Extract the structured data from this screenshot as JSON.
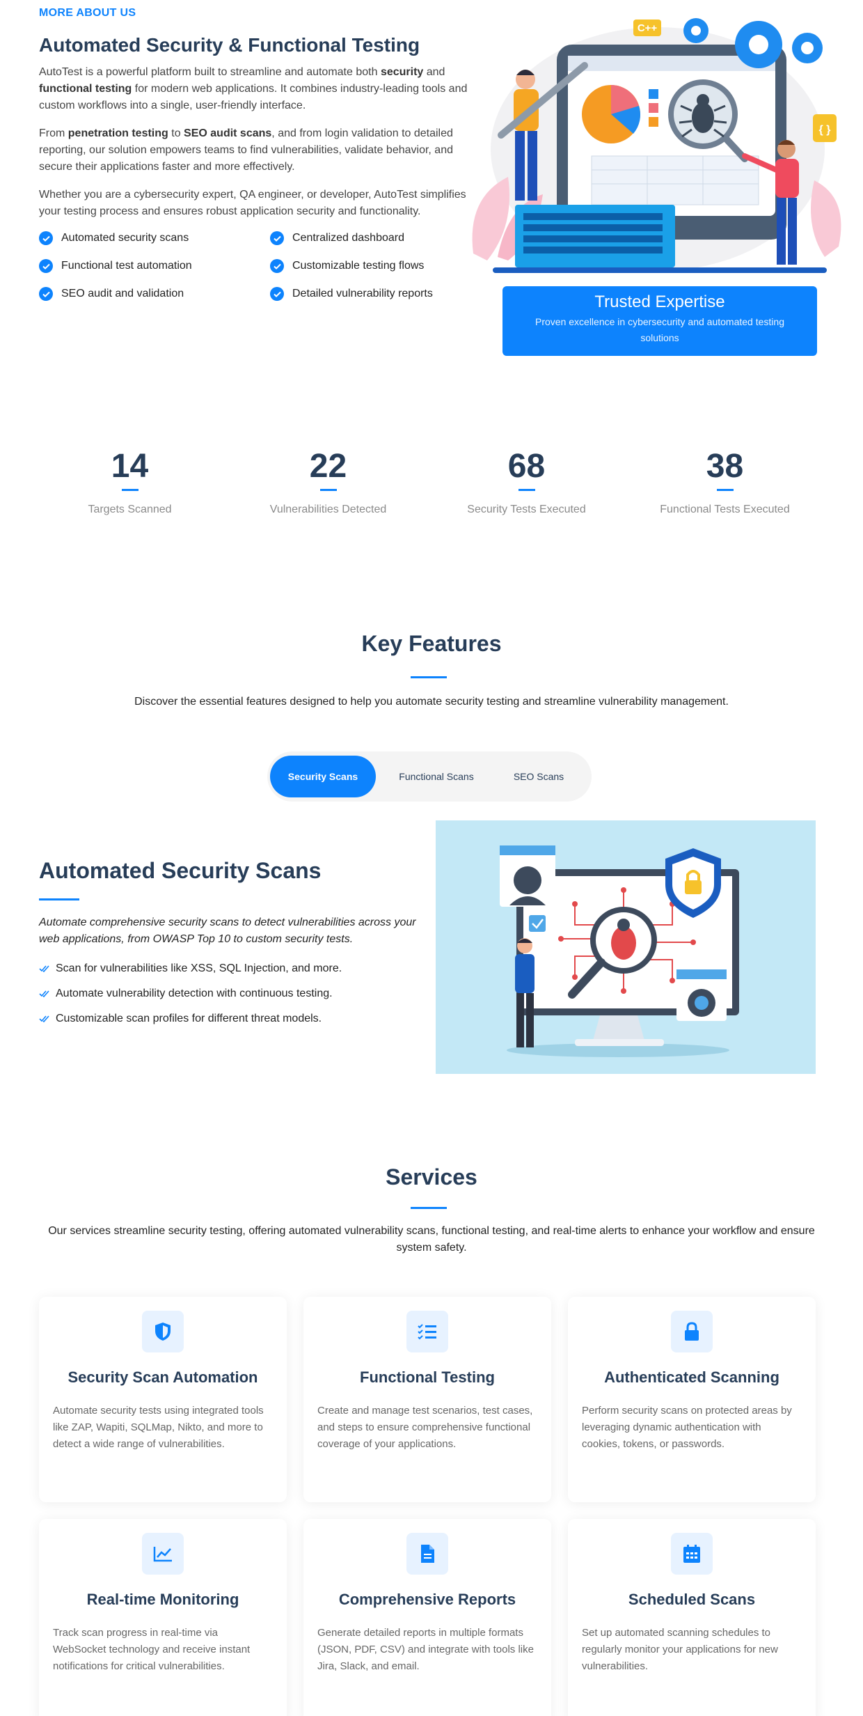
{
  "about": {
    "eyebrow": "MORE ABOUT US",
    "title": "Automated Security & Functional Testing",
    "p1": {
      "t1": "AutoTest is a powerful platform built to streamline and automate both ",
      "b1": "security",
      "t2": " and ",
      "b2": "functional testing",
      "t3": " for modern web applications. It combines industry-leading tools and custom workflows into a single, user-friendly interface."
    },
    "p2": {
      "t1": "From ",
      "b1": "penetration testing",
      "t2": " to ",
      "b2": "SEO audit scans",
      "t3": ", and from login validation to detailed reporting, our solution empowers teams to find vulnerabilities, validate behavior, and secure their applications faster and more effectively."
    },
    "p3": "Whether you are a cybersecurity expert, QA engineer, or developer, AutoTest simplifies your testing process and ensures robust application security and functionality.",
    "checks": [
      "Automated security scans",
      "Centralized dashboard",
      "Functional test automation",
      "Customizable testing flows",
      "SEO audit and validation",
      "Detailed vulnerability reports"
    ],
    "illustration_badges": {
      "cpp": "C++",
      "braces": "{ }"
    },
    "trusted": {
      "title": "Trusted Expertise",
      "subtitle": "Proven excellence in cybersecurity and automated testing solutions"
    }
  },
  "stats": [
    {
      "value": "14",
      "label": "Targets Scanned"
    },
    {
      "value": "22",
      "label": "Vulnerabilities Detected"
    },
    {
      "value": "68",
      "label": "Security Tests Executed"
    },
    {
      "value": "38",
      "label": "Functional Tests Executed"
    }
  ],
  "features": {
    "title": "Key Features",
    "description": "Discover the essential features designed to help you automate security testing and streamline vulnerability management.",
    "tabs": [
      "Security Scans",
      "Functional Scans",
      "SEO Scans"
    ],
    "active_tab": "Security Scans",
    "panel": {
      "title": "Automated Security Scans",
      "description": "Automate comprehensive security scans to detect vulnerabilities across your web applications, from OWASP Top 10 to custom security tests.",
      "items": [
        "Scan for vulnerabilities like XSS, SQL Injection, and more.",
        "Automate vulnerability detection with continuous testing.",
        "Customizable scan profiles for different threat models."
      ]
    }
  },
  "services": {
    "title": "Services",
    "description": "Our services streamline security testing, offering automated vulnerability scans, functional testing, and real-time alerts to enhance your workflow and ensure system safety.",
    "items": [
      {
        "icon": "shield-icon",
        "title": "Security Scan Automation",
        "desc": "Automate security tests using integrated tools like ZAP, Wapiti, SQLMap, Nikto, and more to detect a wide range of vulnerabilities."
      },
      {
        "icon": "list-check-icon",
        "title": "Functional Testing",
        "desc": "Create and manage test scenarios, test cases, and steps to ensure comprehensive functional coverage of your applications."
      },
      {
        "icon": "lock-icon",
        "title": "Authenticated Scanning",
        "desc": "Perform security scans on protected areas by leveraging dynamic authentication with cookies, tokens, or passwords."
      },
      {
        "icon": "chart-line-icon",
        "title": "Real-time Monitoring",
        "desc": "Track scan progress in real-time via WebSocket technology and receive instant notifications for critical vulnerabilities."
      },
      {
        "icon": "document-icon",
        "title": "Comprehensive Reports",
        "desc": "Generate detailed reports in multiple formats (JSON, PDF, CSV) and integrate with tools like Jira, Slack, and email."
      },
      {
        "icon": "calendar-icon",
        "title": "Scheduled Scans",
        "desc": "Set up automated scanning schedules to regularly monitor your applications for new vulnerabilities."
      }
    ]
  },
  "colors": {
    "accent": "#0d83fd",
    "heading": "#273d58",
    "illustration_bg": "#c3e8f6"
  }
}
